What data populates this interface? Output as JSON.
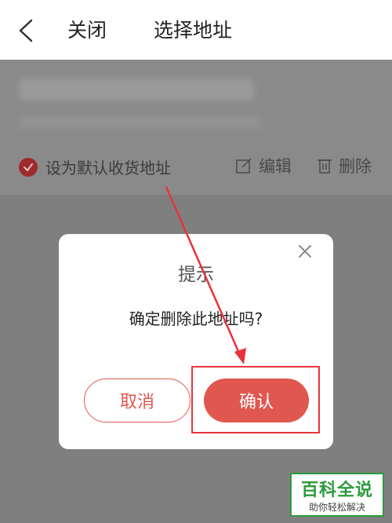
{
  "header": {
    "back_icon": "chevron-left-icon",
    "close_label": "关闭",
    "title": "选择地址"
  },
  "address_card": {
    "default_label": "设为默认收货地址",
    "edit_label": "编辑",
    "delete_label": "删除"
  },
  "dialog": {
    "title": "提示",
    "message": "确定删除此地址吗?",
    "cancel_label": "取消",
    "confirm_label": "确认"
  },
  "watermark": {
    "top": "百科全说",
    "bottom": "助你轻松解决"
  },
  "colors": {
    "accent": "#e0574f",
    "annotation": "#e8333a",
    "watermark": "#2d9a3e"
  }
}
